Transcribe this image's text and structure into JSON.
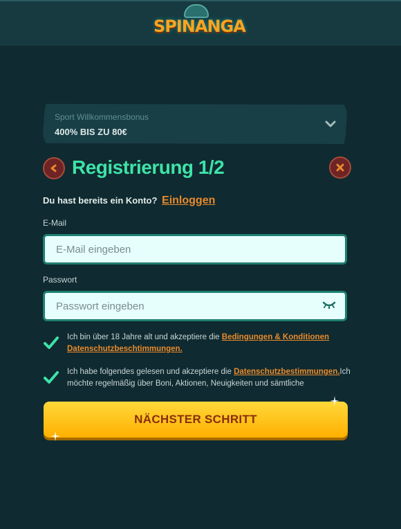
{
  "header": {
    "logo_text": "SPINANGA"
  },
  "bonus": {
    "label": "Sport Willkommensbonus",
    "value": "400% BIS ZU 80€",
    "chevron_icon": "chevron-down-icon"
  },
  "registration": {
    "title": "Registrierung 1/2",
    "back_icon": "chevron-left-icon",
    "close_icon": "close-icon"
  },
  "login": {
    "prompt": "Du hast bereits ein Konto?",
    "link": "Einloggen"
  },
  "email": {
    "label": "E-Mail",
    "placeholder": "E-Mail eingeben"
  },
  "password": {
    "label": "Passwort",
    "placeholder": "Passwort eingeben",
    "toggle_icon": "eye-closed-icon"
  },
  "consent_terms": {
    "text": "Ich bin über 18 Jahre alt und akzeptiere die",
    "link": "Bedingungen & Konditionen Datenschutzbeschtimmungen.",
    "checked": true
  },
  "consent_privacy": {
    "text_before": "Ich habe folgendes gelesen und akzeptiere die",
    "link": "Datenschutzbestimmungen.",
    "text_after": "Ich möchte regelmäßig über Boni, Aktionen, Neuigkeiten und sämtliche",
    "checked": true
  },
  "cta": {
    "label": "NÄCHSTER SCHRITT"
  },
  "colors": {
    "accent": "#3ee3a8",
    "link": "#e88a2c",
    "button": "#ffc21a",
    "background": "#0f2a30"
  }
}
